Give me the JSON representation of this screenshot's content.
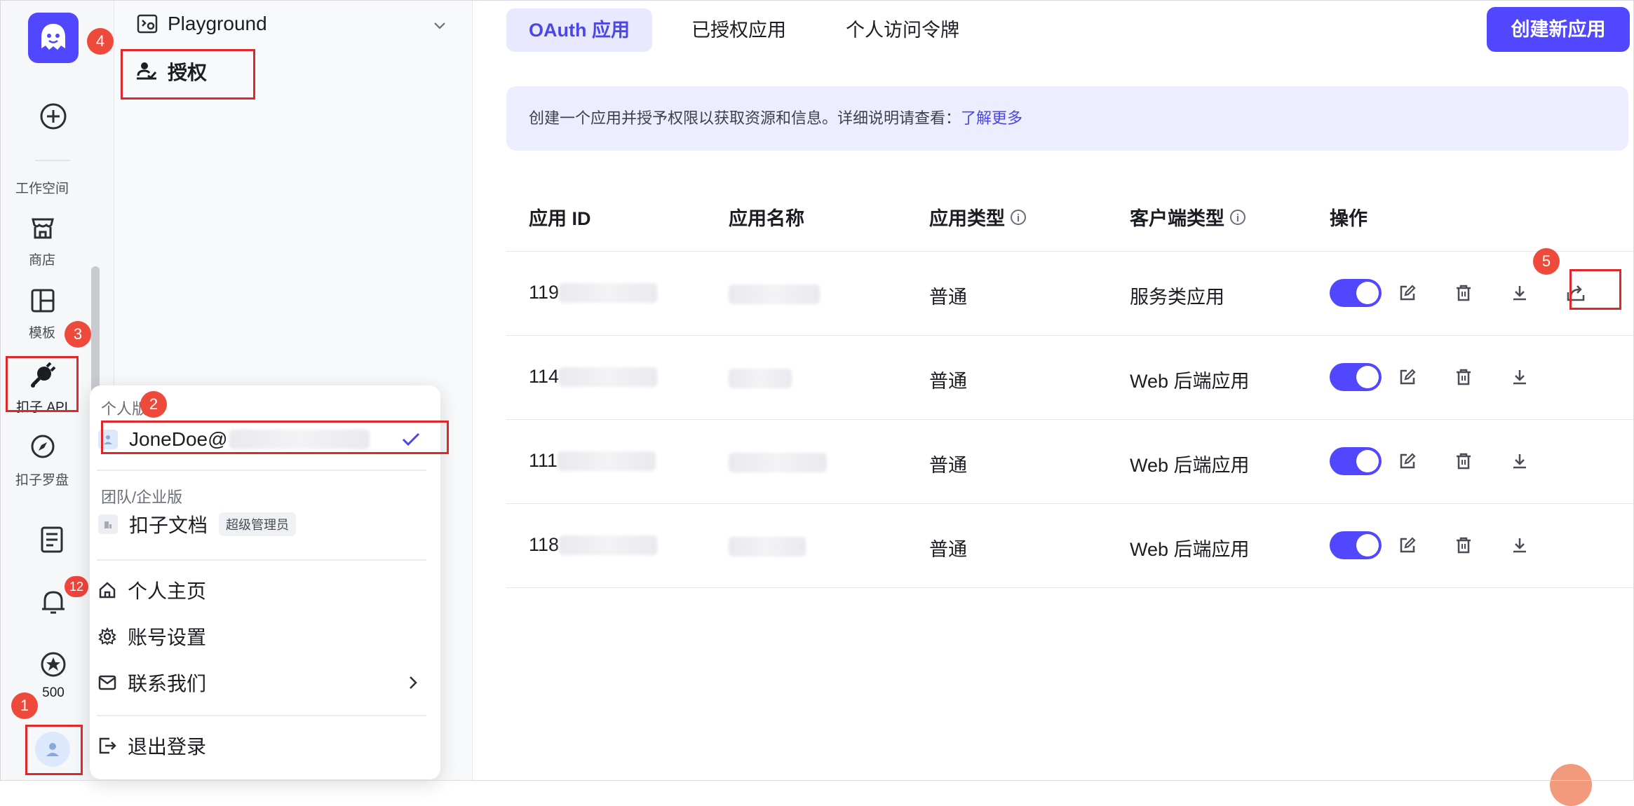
{
  "rail": {
    "workspace_label": "工作空间",
    "store_label": "商店",
    "template_label": "模板",
    "api_label": "扣子 API",
    "compass_label": "扣子罗盘",
    "notification_count": "12",
    "credits": "500"
  },
  "sidebar": {
    "playground_label": "Playground",
    "auth_label": "授权"
  },
  "popup": {
    "personal_heading": "个人版",
    "personal_account": "JoneDoe@",
    "team_heading": "团队/企业版",
    "team_workspace": "扣子文档",
    "team_role": "超级管理员",
    "profile": "个人主页",
    "settings": "账号设置",
    "contact": "联系我们",
    "logout": "退出登录"
  },
  "main": {
    "tabs": [
      {
        "label": "OAuth 应用",
        "active": true
      },
      {
        "label": "已授权应用",
        "active": false
      },
      {
        "label": "个人访问令牌",
        "active": false
      }
    ],
    "create_button": "创建新应用",
    "info_text": "创建一个应用并授予权限以获取资源和信息。详细说明请查看：",
    "info_link": "了解更多",
    "columns": [
      "应用 ID",
      "应用名称",
      "应用类型",
      "客户端类型",
      "操作"
    ],
    "rows": [
      {
        "id_prefix": "119",
        "type": "普通",
        "client": "服务类应用",
        "enabled": true
      },
      {
        "id_prefix": "114",
        "type": "普通",
        "client": "Web 后端应用",
        "enabled": true
      },
      {
        "id_prefix": "111",
        "type": "普通",
        "client": "Web 后端应用",
        "enabled": true
      },
      {
        "id_prefix": "118",
        "type": "普通",
        "client": "Web 后端应用",
        "enabled": true
      }
    ]
  },
  "annotations": [
    "1",
    "2",
    "3",
    "4",
    "5"
  ],
  "colors": {
    "accent": "#5147ff",
    "annotation": "#e0282a"
  }
}
